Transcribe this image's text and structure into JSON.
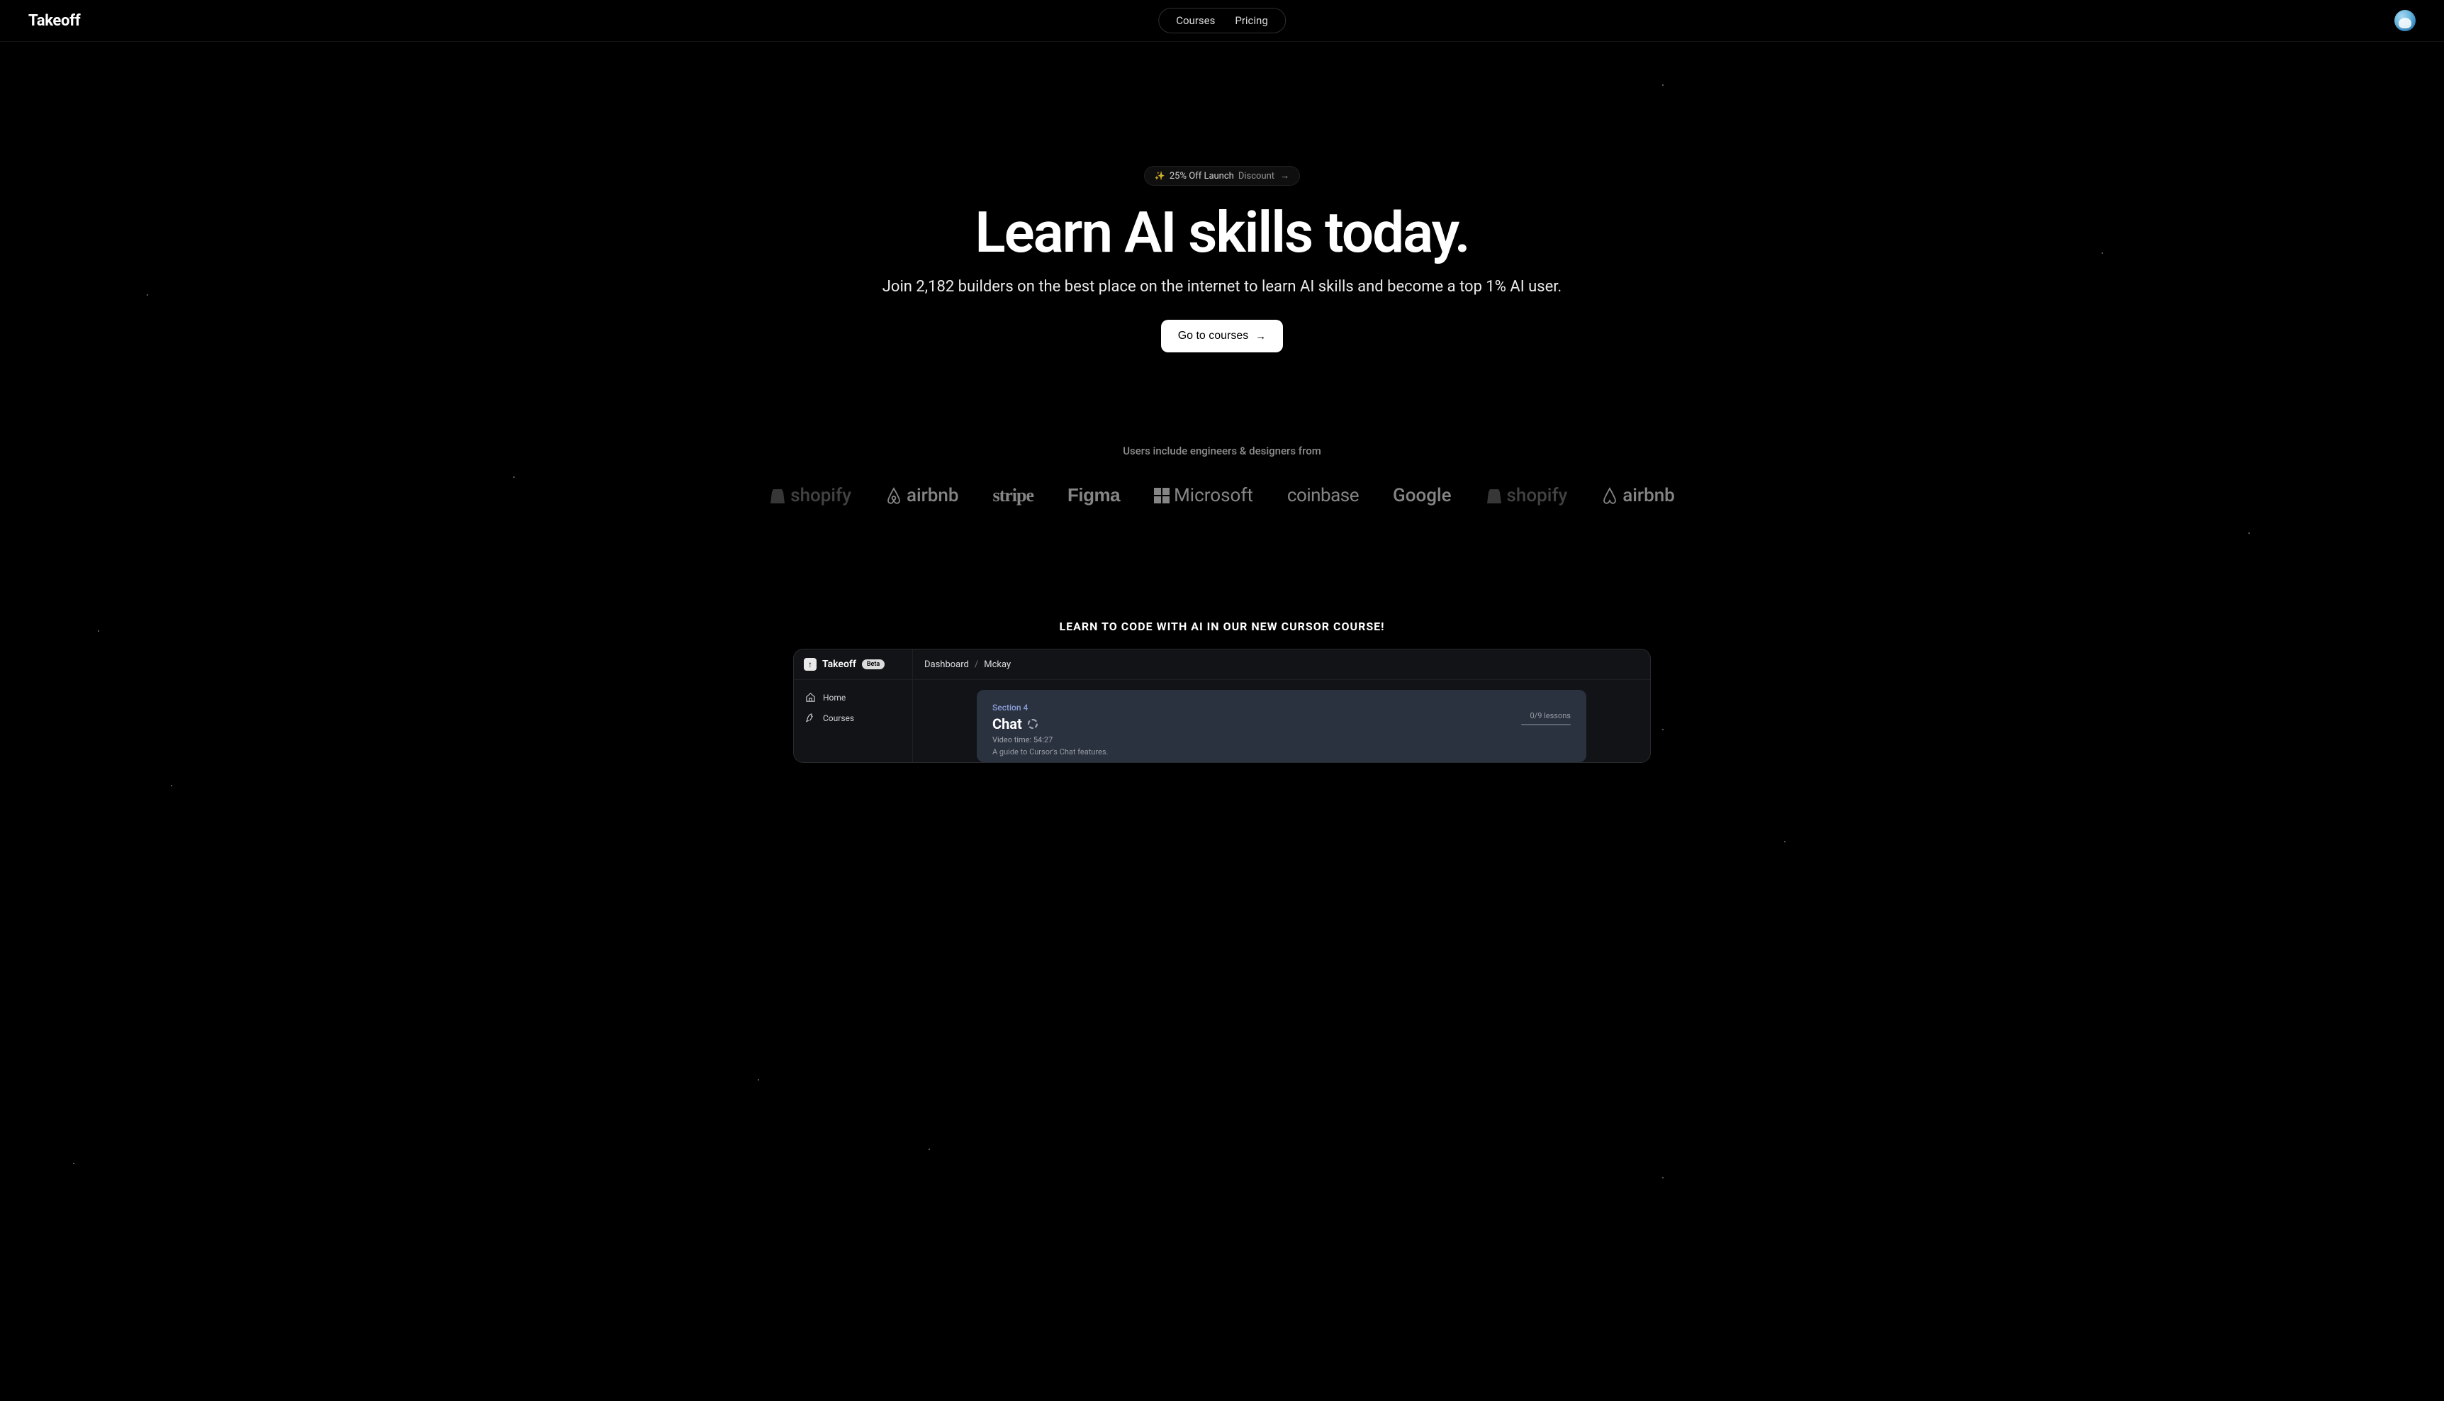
{
  "header": {
    "brand": "Takeoff",
    "nav": [
      "Courses",
      "Pricing"
    ]
  },
  "hero": {
    "promo_prefix": "25% Off Launch",
    "promo_suffix": "Discount",
    "title": "Learn AI skills today.",
    "subtitle": "Join 2,182 builders on the best place on the internet to learn AI skills and become a top 1% AI user.",
    "cta": "Go to courses"
  },
  "logos": {
    "label": "Users include engineers & designers from",
    "items": [
      "shopify",
      "airbnb",
      "stripe",
      "Figma",
      "Microsoft",
      "coinbase",
      "Google",
      "shopify",
      "airbnb"
    ]
  },
  "course": {
    "heading": "LEARN TO CODE WITH AI IN OUR NEW CURSOR COURSE!",
    "mock": {
      "brand": "Takeoff",
      "beta": "Beta",
      "breadcrumb": [
        "Dashboard",
        "Mckay"
      ],
      "sidebar": [
        "Home",
        "Courses"
      ],
      "card": {
        "section": "Section 4",
        "title": "Chat",
        "video_time": "Video time: 54:27",
        "desc": "A guide to Cursor's Chat features.",
        "progress": "0/9 lessons"
      }
    }
  }
}
